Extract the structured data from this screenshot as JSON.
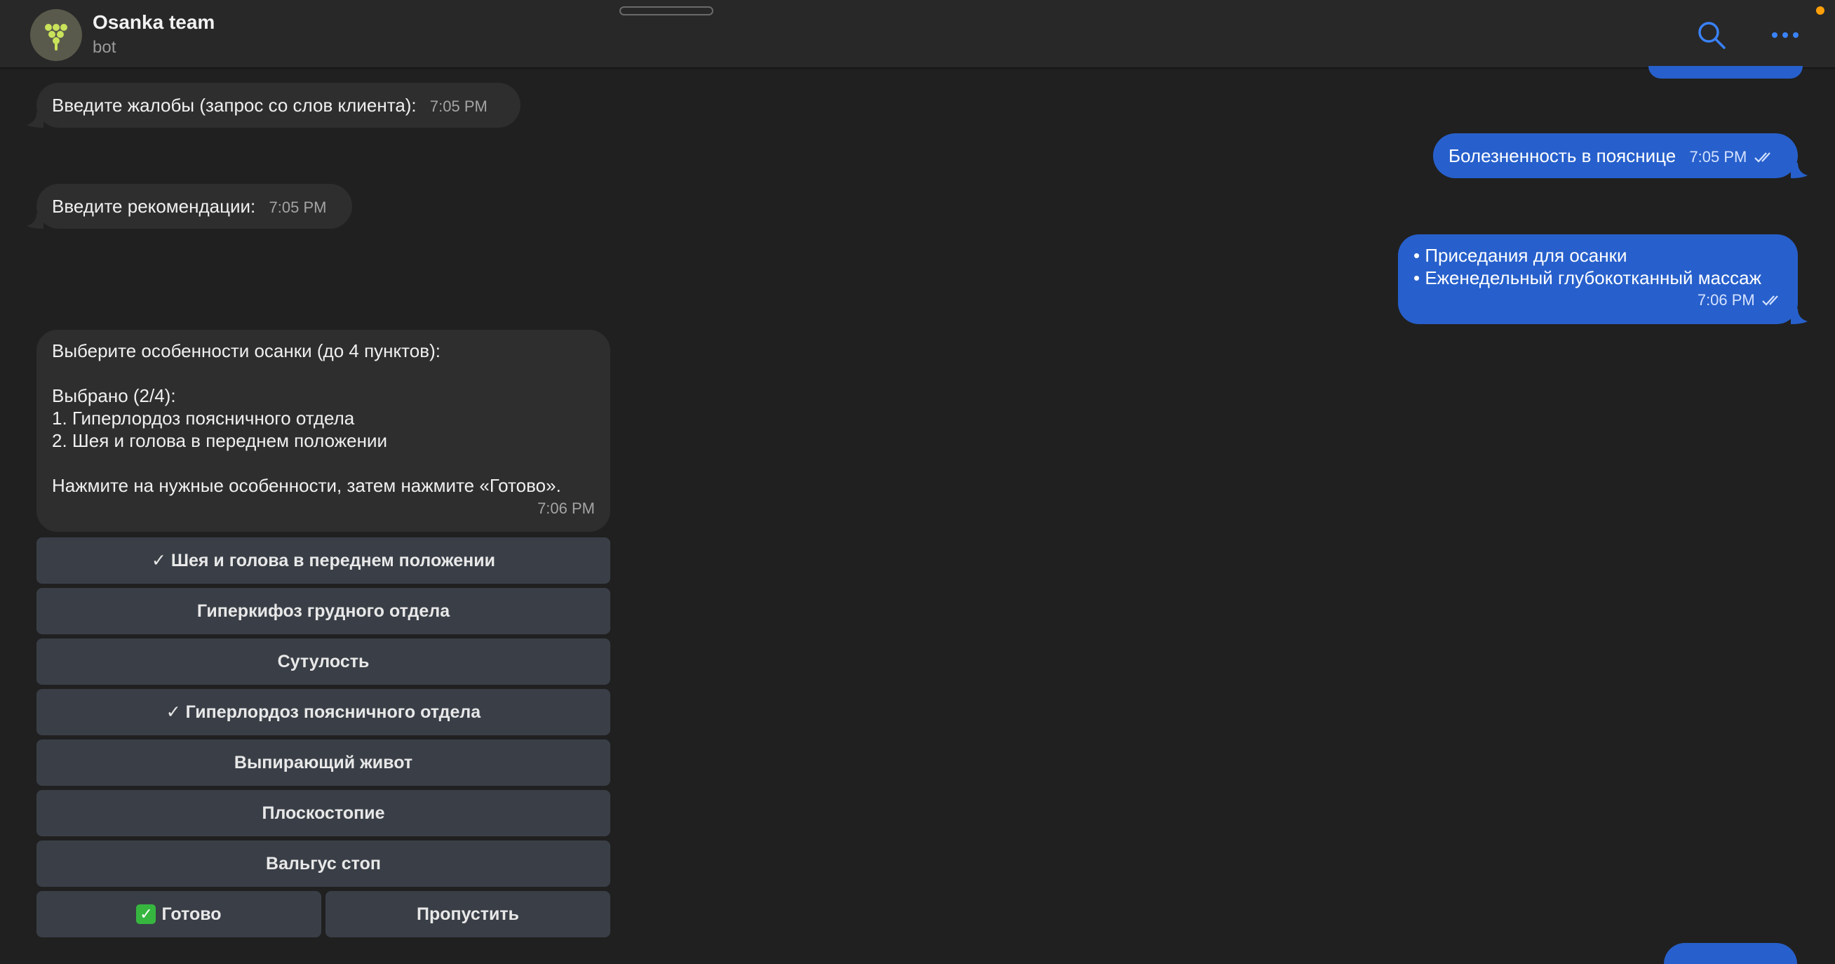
{
  "header": {
    "title": "Osanka team",
    "subtitle": "bot"
  },
  "messages": [
    {
      "text": "Введите жалобы (запрос со слов клиента):",
      "time": "7:05 PM"
    },
    {
      "text": "Болезненность в пояснице",
      "time": "7:05 PM"
    },
    {
      "text": "Введите рекомендации:",
      "time": "7:05 PM"
    },
    {
      "lines": [
        "• Приседания для осанки",
        "• Еженедельный глубокотканный массаж"
      ],
      "time": "7:06 PM"
    },
    {
      "lines": [
        "Выберите особенности осанки (до 4 пунктов):",
        "",
        "Выбрано (2/4):",
        "1. Гиперлордоз поясничного отдела",
        "2. Шея и голова в переднем положении",
        "",
        "Нажмите на нужные особенности, затем нажмите «Готово»."
      ],
      "time": "7:06 PM"
    }
  ],
  "keyboard": {
    "buttons": [
      "✓ Шея и голова в переднем положении",
      "Гиперкифоз грудного отдела",
      "Сутулость",
      "✓ Гиперлордоз поясничного отдела",
      "Выпирающий живот",
      "Плоскостопие",
      "Вальгус стоп"
    ],
    "done": "Готово",
    "skip": "Пропустить"
  },
  "colors": {
    "background": "#202020",
    "incoming_bubble": "#2e2e2e",
    "outgoing_bubble": "#2760cc",
    "accent": "#3a82f7",
    "keyboard_button": "#3a3f47",
    "done_checkbox": "#36b63f"
  },
  "icons": [
    "avatar-logo-icon",
    "search-icon",
    "more-icon",
    "double-check-icon",
    "checkmark-icon"
  ]
}
